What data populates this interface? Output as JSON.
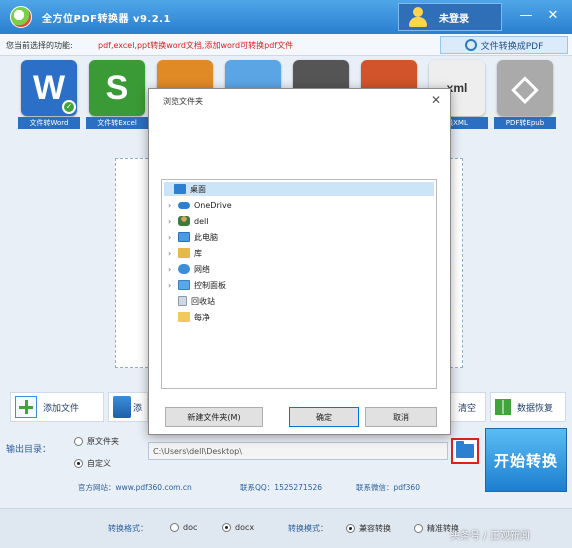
{
  "app": {
    "title": "全方位PDF转换器 v9.2.1",
    "login_label": "未登录",
    "minimize_glyph": "—",
    "close_glyph": "✕"
  },
  "hint": {
    "label": "您当前选择的功能:",
    "text": "pdf,excel,ppt转换word文档,添加word可转换pdf文件",
    "to_pdf_button": "文件转换成PDF"
  },
  "tiles": [
    {
      "label": "文件转Word",
      "glyph": "W",
      "color": "#2b6fc7"
    },
    {
      "label": "文件转Excel",
      "glyph": "S",
      "color": "#3a9a35"
    },
    {
      "label": "",
      "glyph": "",
      "color": "#e08a25"
    },
    {
      "label": "",
      "glyph": "",
      "color": "#5ba5e5"
    },
    {
      "label": "",
      "glyph": "",
      "color": "#555555"
    },
    {
      "label": "",
      "glyph": "",
      "color": "#d1542a"
    },
    {
      "label": "换XML",
      "glyph": "xml",
      "color": "#eeeeee"
    },
    {
      "label": "PDF转Epub",
      "glyph": "◇",
      "color": "#aaaaaa"
    }
  ],
  "toolbar": {
    "add_file": "添加文件",
    "add_folder_partial": "添",
    "clear": "清空",
    "data_reset": "数据恢复"
  },
  "output": {
    "label": "输出目录：",
    "option_original": "原文件夹",
    "option_custom": "自定义",
    "path": "C:\\Users\\dell\\Desktop\\",
    "start_button": "开始转换"
  },
  "info": {
    "site": "官方网站：www.pdf360.com.cn",
    "qq": "联系QQ：1525271526",
    "wechat": "联系微信：pdf360"
  },
  "mode": {
    "format_label": "转换格式：",
    "format_doc": "doc",
    "format_docx": "docx",
    "mode_label": "转换模式：",
    "mode_compat": "兼容转换",
    "mode_precise": "精准转换",
    "watermark": "头条号 / 正观新闻"
  },
  "dialog": {
    "title": "浏览文件夹",
    "close_glyph": "✕",
    "tree": [
      {
        "label": "桌面",
        "icon": "desktop-icon",
        "root": true
      },
      {
        "label": "OneDrive",
        "icon": "cloud-icon"
      },
      {
        "label": "dell",
        "icon": "user-icon"
      },
      {
        "label": "此电脑",
        "icon": "computer-icon"
      },
      {
        "label": "库",
        "icon": "library-icon"
      },
      {
        "label": "网络",
        "icon": "network-icon"
      },
      {
        "label": "控制面板",
        "icon": "control-panel-icon"
      },
      {
        "label": "回收站",
        "icon": "recycle-bin-icon"
      },
      {
        "label": "每净",
        "icon": "folder-icon"
      }
    ],
    "new_folder": "新建文件夹(M)",
    "ok": "确定",
    "cancel": "取消"
  }
}
